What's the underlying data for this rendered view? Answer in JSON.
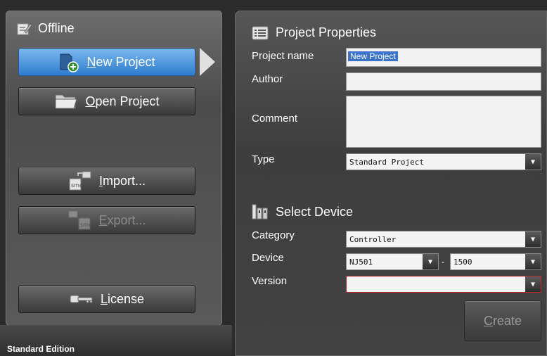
{
  "sidebar": {
    "header": "Offline",
    "buttons": {
      "new_project_prefix": "",
      "new_project_mnemonic": "N",
      "new_project_rest": "ew Project",
      "open_project_mnemonic": "O",
      "open_project_rest": "pen Project",
      "import_mnemonic": "I",
      "import_rest": "mport...",
      "export_mnemonic": "E",
      "export_rest": "xport...",
      "license_mnemonic": "L",
      "license_rest": "icense"
    },
    "edition": "Standard Edition"
  },
  "project_properties": {
    "title": "Project Properties",
    "project_name_label": "Project name",
    "project_name_value": "New Project",
    "author_label": "Author",
    "author_value": "",
    "comment_label": "Comment",
    "comment_value": "",
    "type_label": "Type",
    "type_value": "Standard Project"
  },
  "select_device": {
    "title": "Select Device",
    "category_label": "Category",
    "category_value": "Controller",
    "device_label": "Device",
    "device_value": "NJ501",
    "device_dash": "-",
    "device_model_value": "1500",
    "version_label": "Version",
    "version_value": ""
  },
  "actions": {
    "create_mnemonic": "C",
    "create_rest": "reate"
  },
  "colors": {
    "accent": "#3a80d0",
    "panel": "#4a4a4a",
    "version_error_border": "#c0282b"
  }
}
